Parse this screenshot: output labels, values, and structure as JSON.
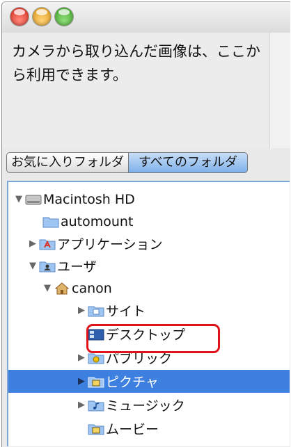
{
  "window": {
    "controls": [
      "close-button",
      "minimize-button",
      "zoom-button"
    ],
    "description_text": "カメラから取り込んだ画像は、ここから利用できます。"
  },
  "tabs": {
    "favorites": "お気に入りフォルダ",
    "all_folders": "すべてのフォルダ",
    "selected": "all_folders"
  },
  "tree": {
    "items": [
      {
        "label": "Macintosh HD",
        "icon": "hard-drive-icon",
        "expanded": true
      },
      {
        "label": "automount",
        "icon": "folder-icon",
        "expanded": null
      },
      {
        "label": "アプリケーション",
        "icon": "applications-folder-icon",
        "expanded": false
      },
      {
        "label": "ユーザ",
        "icon": "users-folder-icon",
        "expanded": true
      },
      {
        "label": "canon",
        "icon": "home-folder-icon",
        "expanded": true
      },
      {
        "label": "サイト",
        "icon": "sites-folder-icon",
        "expanded": false
      },
      {
        "label": "デスクトップ",
        "icon": "desktop-folder-icon",
        "expanded": null,
        "highlighted": true
      },
      {
        "label": "パブリック",
        "icon": "public-folder-icon",
        "expanded": false
      },
      {
        "label": "ピクチャ",
        "icon": "pictures-folder-icon",
        "expanded": false,
        "selected": true
      },
      {
        "label": "ミュージック",
        "icon": "music-folder-icon",
        "expanded": false
      },
      {
        "label": "ムービー",
        "icon": "movies-folder-icon",
        "expanded": null
      }
    ]
  },
  "colors": {
    "selection": "#3d80df",
    "highlight_border": "#e0121a",
    "tab_active": "#7fb1ea"
  }
}
